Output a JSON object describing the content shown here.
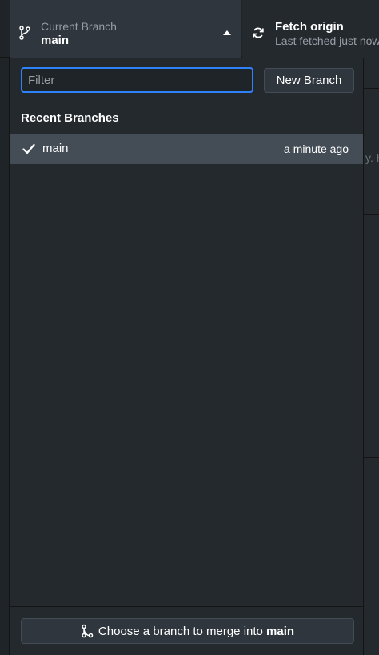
{
  "toolbar": {
    "current_branch": {
      "label": "Current Branch",
      "value": "main",
      "icon": "git-branch-icon"
    },
    "fetch": {
      "title": "Fetch origin",
      "subtitle": "Last fetched just now",
      "icon": "sync-icon"
    }
  },
  "background": {
    "ghost_text": "y. H"
  },
  "branch_panel": {
    "filter": {
      "placeholder": "Filter",
      "value": ""
    },
    "new_branch_label": "New Branch",
    "section_title": "Recent Branches",
    "branches": [
      {
        "name": "main",
        "time": "a minute ago",
        "checked": true
      }
    ],
    "merge_button": {
      "prefix": "Choose a branch to merge into ",
      "branch": "main"
    }
  },
  "colors": {
    "accent": "#2f81f7",
    "selected_row": "#444d56",
    "panel_bg": "#24292e"
  }
}
